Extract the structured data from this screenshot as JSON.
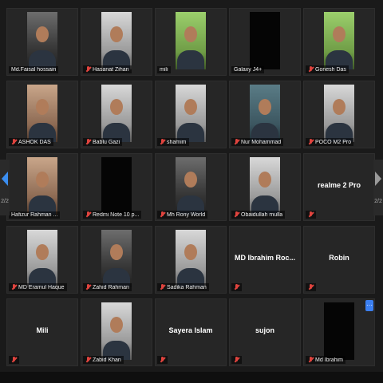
{
  "pagination": {
    "left_page": "2/2",
    "right_page": "2/2"
  },
  "more_button_glyph": "···",
  "participants": [
    {
      "name": "Md.Faisal hossain",
      "video": "normal",
      "muted": false,
      "center_name": ""
    },
    {
      "name": "Hasanat Zihan",
      "video": "light",
      "muted": true,
      "center_name": ""
    },
    {
      "name": "mili",
      "video": "green",
      "muted": false,
      "center_name": ""
    },
    {
      "name": "Galaxy J4+",
      "video": "dark",
      "muted": false,
      "center_name": ""
    },
    {
      "name": "Gonesh Das",
      "video": "green",
      "muted": true,
      "center_name": ""
    },
    {
      "name": "ASHOK DAS",
      "video": "warm",
      "muted": true,
      "center_name": ""
    },
    {
      "name": "Bablu Gazi",
      "video": "light",
      "muted": true,
      "center_name": ""
    },
    {
      "name": "shamim",
      "video": "light",
      "muted": true,
      "center_name": ""
    },
    {
      "name": "Nur Mohammad",
      "video": "teal",
      "muted": true,
      "center_name": ""
    },
    {
      "name": "POCO M2 Pro",
      "video": "light",
      "muted": true,
      "center_name": ""
    },
    {
      "name": "Hafizur Rahman ...",
      "video": "warm",
      "muted": false,
      "center_name": ""
    },
    {
      "name": "Redmi Note 10 p...",
      "video": "dark",
      "muted": true,
      "center_name": ""
    },
    {
      "name": "Mh Rony World",
      "video": "normal",
      "muted": true,
      "center_name": ""
    },
    {
      "name": "Obaidullah mulla",
      "video": "light",
      "muted": true,
      "center_name": ""
    },
    {
      "name": "",
      "video": "none",
      "muted": true,
      "center_name": "realme 2 Pro"
    },
    {
      "name": "MD Eramul Haque",
      "video": "light",
      "muted": true,
      "center_name": ""
    },
    {
      "name": "Zahid Rahman",
      "video": "normal",
      "muted": true,
      "center_name": ""
    },
    {
      "name": "Sadika Rahman",
      "video": "light",
      "muted": true,
      "center_name": ""
    },
    {
      "name": "",
      "video": "none",
      "muted": true,
      "center_name": "MD Ibrahim Roc..."
    },
    {
      "name": "",
      "video": "none",
      "muted": true,
      "center_name": "Robin"
    },
    {
      "name": "",
      "video": "none",
      "muted": true,
      "center_name": "Mili"
    },
    {
      "name": "Zabid Khan",
      "video": "light",
      "muted": true,
      "center_name": ""
    },
    {
      "name": "",
      "video": "none",
      "muted": true,
      "center_name": "Sayera Islam"
    },
    {
      "name": "",
      "video": "none",
      "muted": true,
      "center_name": "sujon"
    },
    {
      "name": "Md Ibrahim",
      "video": "dark",
      "muted": true,
      "center_name": ""
    }
  ]
}
